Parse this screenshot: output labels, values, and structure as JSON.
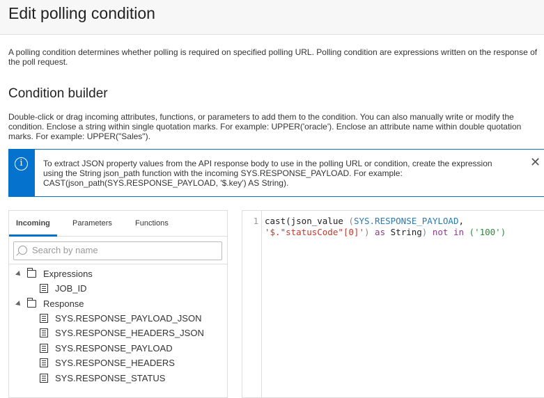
{
  "header": {
    "title": "Edit polling condition"
  },
  "description": "A polling condition determines whether polling is required on specified polling URL. Polling condition are expressions written on the response of the poll request.",
  "builder": {
    "title": "Condition builder",
    "description_line1": "Double-click or drag incoming attributes, functions, or parameters to add them to the condition. You can also manually write or modify the",
    "description_line2": "condition. Enclose a string within single quotation marks. For example: UPPER('oracle'). Enclose an attribute name within double quotation",
    "description_line3": "marks. For example: UPPER(\"Sales\")."
  },
  "info": {
    "icon": "info-icon",
    "line1": "To extract JSON property values from the API response body to use in the polling URL or condition, create the expression",
    "line2": "using the String json_path function with the incoming SYS.RESPONSE_PAYLOAD. For example:",
    "line3": "CAST(json_path(SYS.RESPONSE_PAYLOAD, '$.key') AS String).",
    "close": "✕"
  },
  "tabs": [
    {
      "label": "Incoming"
    },
    {
      "label": "Parameters"
    },
    {
      "label": "Functions"
    }
  ],
  "search": {
    "placeholder": "Search by name"
  },
  "tree": {
    "folders": [
      {
        "label": "Expressions",
        "items": [
          "JOB_ID"
        ]
      },
      {
        "label": "Response",
        "items": [
          "SYS.RESPONSE_PAYLOAD_JSON",
          "SYS.RESPONSE_HEADERS_JSON",
          "SYS.RESPONSE_PAYLOAD",
          "SYS.RESPONSE_HEADERS",
          "SYS.RESPONSE_STATUS"
        ]
      }
    ]
  },
  "editor": {
    "line_number": "1",
    "tokens": {
      "t1": "cast(json_value ",
      "t2": "(",
      "t3": "SYS.RESPONSE_PAYLOAD",
      "t4": ",",
      "t5": "'$.\"statusCode\"[0]'",
      "t6": ")",
      "t7": " as ",
      "t8": "String",
      "t9": ")",
      "t10": " not in ",
      "t11": "(",
      "t12": "'100'",
      "t13": ")"
    }
  }
}
